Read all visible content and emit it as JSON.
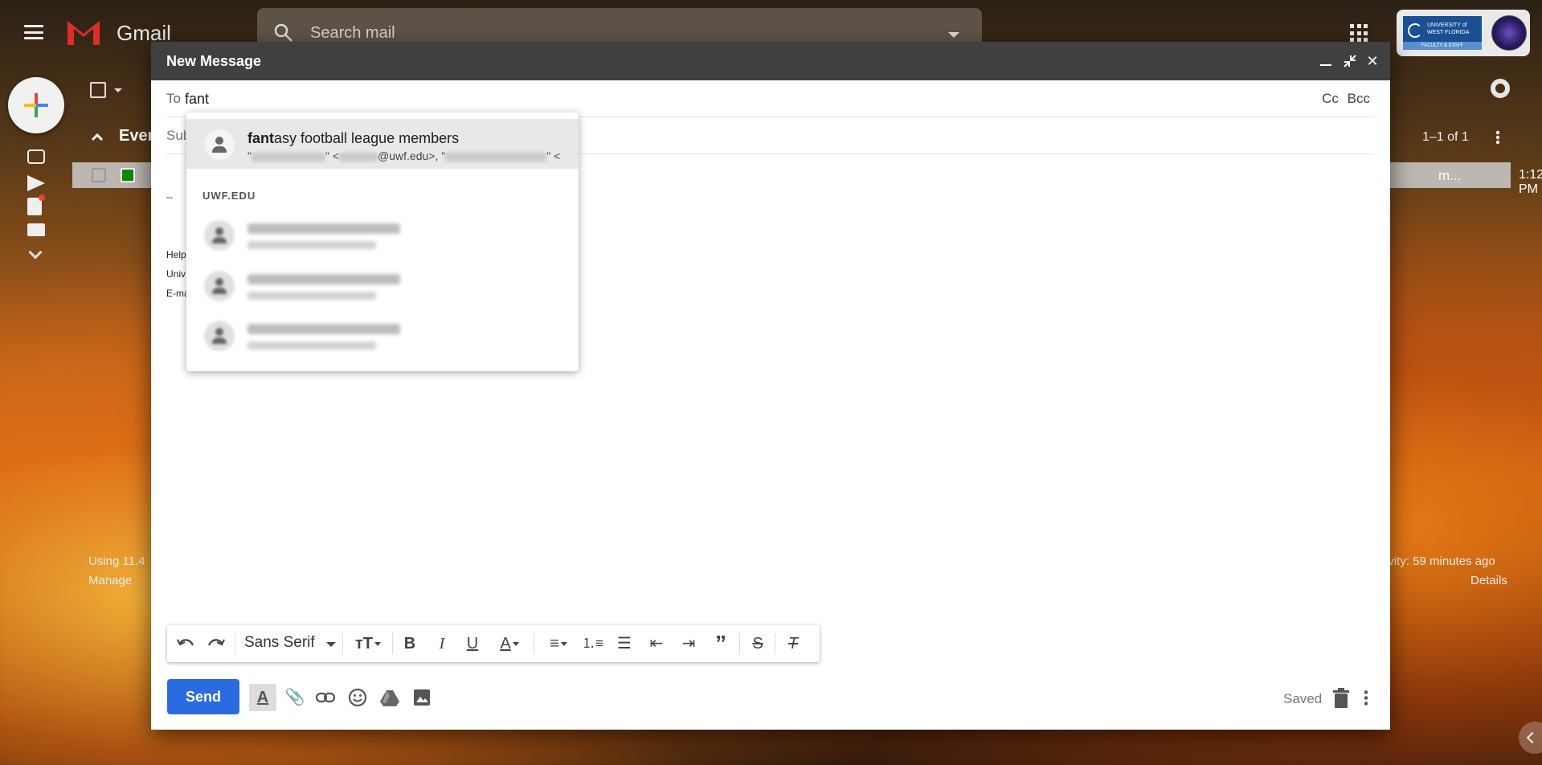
{
  "app": {
    "name": "Gmail",
    "search_placeholder": "Search mail"
  },
  "background": {
    "section_title": "Ever",
    "pager": "1–1 of 1",
    "row_snippet": "m...",
    "row_time": "1:12 PM",
    "storage_text": "Using 11.4",
    "manage_link": "Manage",
    "activity_text": "ivity: 59 minutes ago",
    "details_link": "Details"
  },
  "account": {
    "org_line1": "UNIVERSITY of",
    "org_line2": "WEST FLORIDA",
    "org_sub": "FACULTY & STAFF"
  },
  "compose": {
    "title": "New Message",
    "to_label": "To",
    "to_value": "fant",
    "cc_label": "Cc",
    "bcc_label": "Bcc",
    "subject_placeholder": "Subject",
    "signature_lines": [
      "--",
      "",
      "Help",
      "Univ",
      "E-ma"
    ]
  },
  "autocomplete": {
    "suggestion": {
      "name_match": "fant",
      "name_rest": "asy football league members",
      "emails_fragment_1": "\"",
      "emails_fragment_2": "\" <",
      "emails_fragment_3": "@uwf.edu>, \"",
      "emails_fragment_4": "\" <"
    },
    "section_header": "UWF.EDU"
  },
  "toolbar": {
    "font": "Sans Serif"
  },
  "footer": {
    "send_label": "Send",
    "saved_label": "Saved"
  },
  "colors": {
    "send_blue": "#2a6ce0",
    "header_dark": "#404040"
  },
  "icons": [
    "undo-icon",
    "redo-icon",
    "text-size-icon",
    "bold-icon",
    "italic-icon",
    "underline-icon",
    "text-color-icon",
    "align-icon",
    "numbered-list-icon",
    "bulleted-list-icon",
    "indent-less-icon",
    "indent-more-icon",
    "quote-icon",
    "strikethrough-icon",
    "remove-formatting-icon",
    "attach-icon",
    "link-icon",
    "emoji-icon",
    "drive-icon",
    "photo-icon",
    "trash-icon",
    "more-options-icon"
  ]
}
